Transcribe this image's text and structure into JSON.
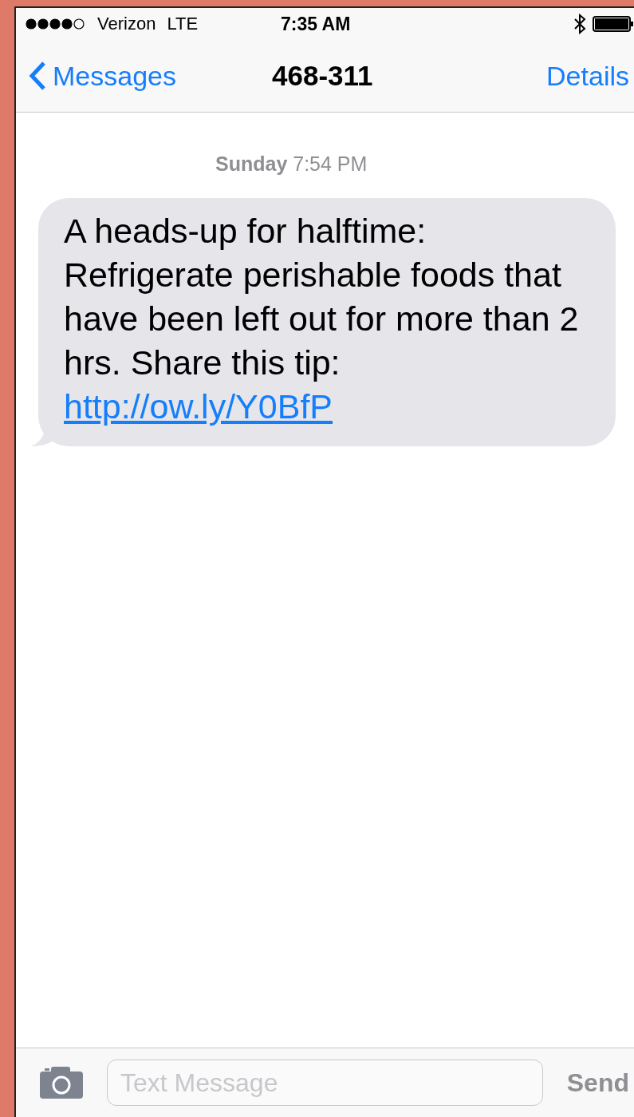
{
  "status_bar": {
    "carrier": "Verizon",
    "network": "LTE",
    "time": "7:35 AM"
  },
  "nav": {
    "back": "Messages",
    "title": "468-311",
    "action": "Details"
  },
  "thread": {
    "timestamp": "**Sunday** 7:54 PM",
    "messages": [
      {
        "kind": "incoming",
        "text": "A heads-up for halftime: Refrigerate perishable foods that have been left out for more than 2 hrs. Share this tip: ",
        "link": "http://ow.ly/Y0BfP"
      }
    ]
  },
  "composer": {
    "placeholder": "Text Message",
    "send": "Send"
  }
}
